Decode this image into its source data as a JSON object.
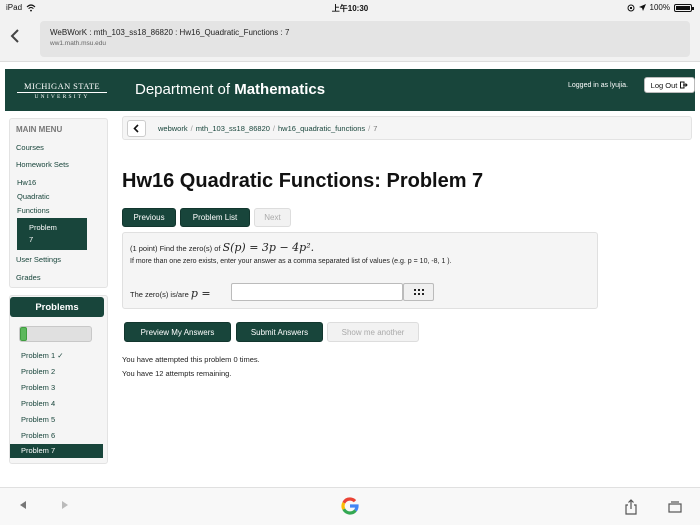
{
  "statusbar": {
    "device": "iPad",
    "time": "上午10:30",
    "battery": "100%"
  },
  "browser": {
    "page_title": "WeBWorK : mth_103_ss18_86820 : Hw16_Quadratic_Functions : 7",
    "url": "ww1.math.msu.edu"
  },
  "header": {
    "logo_line1": "MICHIGAN STATE",
    "logo_line2": "UNIVERSITY",
    "dept_prefix": "Department of",
    "dept_strong": "Mathematics",
    "logged_in": "Logged in as lyujia.",
    "logout_label": "Log Out"
  },
  "sidebar": {
    "heading": "MAIN MENU",
    "courses": "Courses",
    "homework_sets": "Homework Sets",
    "current_set_lines": [
      "Hw16",
      "Quadratic",
      "Functions"
    ],
    "current_problem_lines": [
      "Problem",
      "7"
    ],
    "user_settings": "User Settings",
    "grades": "Grades"
  },
  "problems_panel": {
    "title": "Problems",
    "progress": 0.1,
    "items": [
      {
        "label": "Problem 1",
        "mark": "✓"
      },
      {
        "label": "Problem 2",
        "mark": ""
      },
      {
        "label": "Problem 3",
        "mark": ""
      },
      {
        "label": "Problem 4",
        "mark": ""
      },
      {
        "label": "Problem 5",
        "mark": ""
      },
      {
        "label": "Problem 6",
        "mark": ""
      }
    ],
    "active_item": "Problem 7"
  },
  "breadcrumb": {
    "items": [
      "webwork",
      "mth_103_ss18_86820",
      "hw16_quadratic_functions"
    ],
    "current": "7"
  },
  "main": {
    "title": "Hw16 Quadratic Functions: Problem 7",
    "nav": {
      "previous": "Previous",
      "problem_list": "Problem List",
      "next": "Next"
    },
    "problem": {
      "points": "(1 point) Find the zero(s) of",
      "function": "S(p) = 3p − 4p².",
      "instruction": "If more than one zero exists, enter your answer as a comma separated list of values (e.g. p = 10, -8, 1 ).",
      "answer_label": "The zero(s) is/are",
      "answer_var": "p =",
      "answer_value": ""
    },
    "actions": {
      "preview": "Preview My Answers",
      "submit": "Submit Answers",
      "show_another": "Show me another"
    },
    "attempts_made": "You have attempted this problem 0 times.",
    "attempts_left": "You have 12 attempts remaining."
  },
  "icons": {
    "wifi": "wifi-icon",
    "location": "location-arrow-icon",
    "battery": "battery-icon",
    "back": "chevron-left-icon",
    "logout": "sign-out-icon",
    "keypad": "keypad-icon",
    "google": "google-logo-icon",
    "share": "share-icon",
    "tabs": "tabs-icon"
  }
}
